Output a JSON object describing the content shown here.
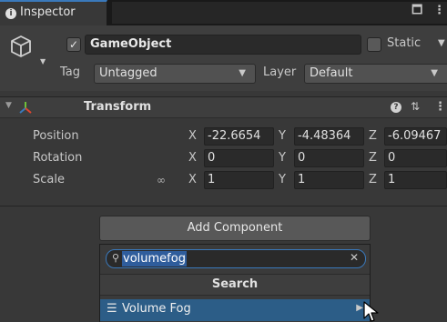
{
  "colors": {
    "accent": "#3a79bb",
    "selection": "#2c5d87",
    "panel": "#383838"
  },
  "tab": {
    "label": "Inspector",
    "icon": "info-icon"
  },
  "game_object": {
    "name": "GameObject",
    "active": true,
    "static_label": "Static",
    "static_checked": false,
    "tag_label": "Tag",
    "tag_value": "Untagged",
    "layer_label": "Layer",
    "layer_value": "Default"
  },
  "transform": {
    "title": "Transform",
    "rows": [
      {
        "label": "Position",
        "x": "-22.6654",
        "y": "-4.48364",
        "z": "-6.09467"
      },
      {
        "label": "Rotation",
        "x": "0",
        "y": "0",
        "z": "0"
      },
      {
        "label": "Scale",
        "x": "1",
        "y": "1",
        "z": "1"
      }
    ],
    "axis_labels": {
      "x": "X",
      "y": "Y",
      "z": "Z"
    }
  },
  "add_component": {
    "button_label": "Add Component",
    "search_query": "volumefog",
    "popup_title": "Search",
    "results": [
      {
        "label": "Volume Fog",
        "icon": "script-list-icon"
      }
    ]
  }
}
